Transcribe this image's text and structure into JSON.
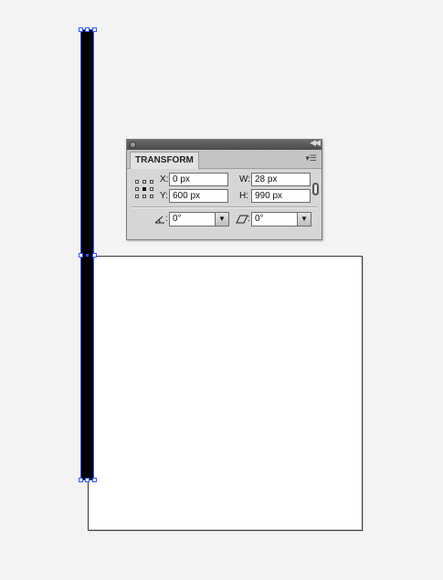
{
  "transform_panel": {
    "tab_label": "TRANSFORM",
    "x_label": "X:",
    "y_label": "Y:",
    "w_label": "W:",
    "h_label": "H:",
    "x_value": "0 px",
    "y_value": "600 px",
    "w_value": "28 px",
    "h_value": "990 px",
    "rotate_value": "0°",
    "shear_value": "0°",
    "rotate_label": ":",
    "shear_label": ":",
    "reference_point": "center",
    "constrain_proportions": false
  },
  "colors": {
    "canvas_bg": "#f3f3f3",
    "artboard": "#ffffff",
    "shape_fill": "#000000",
    "selection": "#2a55ff"
  },
  "icons": [
    "rotate-angle-icon",
    "shear-angle-icon",
    "link-icon",
    "panel-menu-icon",
    "reference-point-icon",
    "close-icon",
    "collapse-icon"
  ]
}
